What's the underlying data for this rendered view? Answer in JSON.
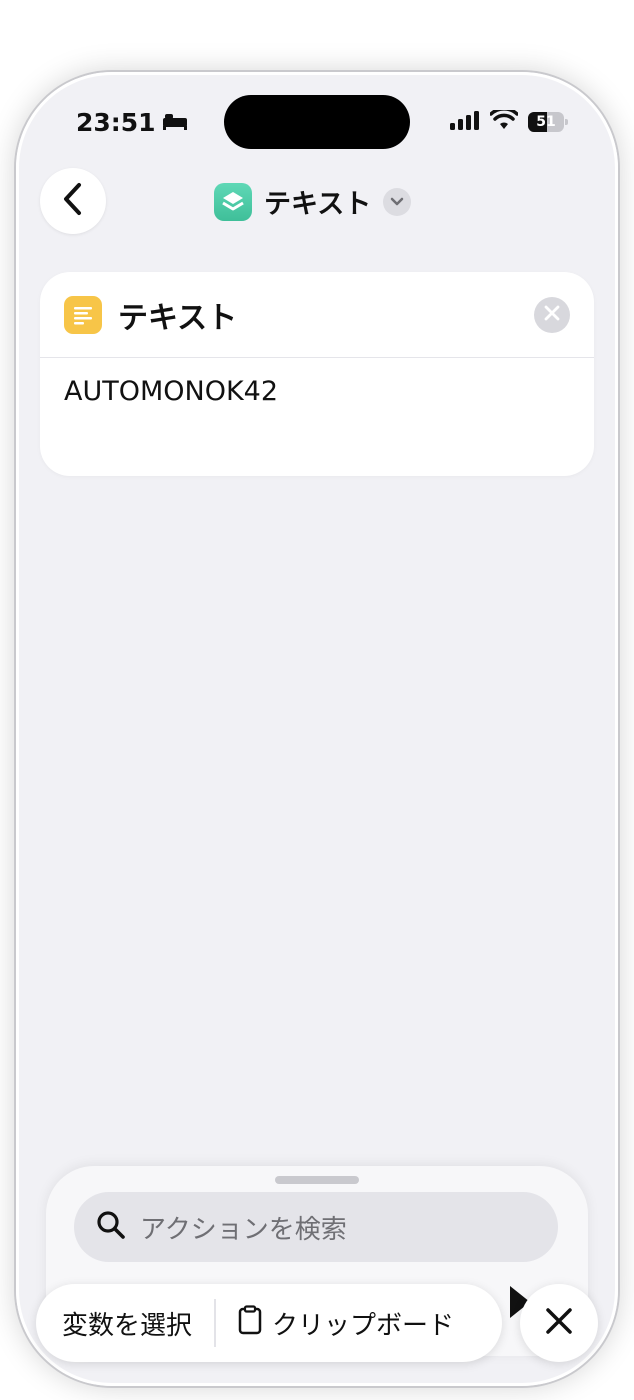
{
  "status_bar": {
    "time": "23:51",
    "battery": "51",
    "sleep_icon": "bed-icon",
    "signal_icon": "cellular-signal-icon",
    "wifi_icon": "wifi-icon"
  },
  "nav": {
    "back_icon": "chevron-left-icon",
    "title": "テキスト",
    "app_icon": "shortcuts-layers-icon",
    "menu_icon": "chevron-down-icon"
  },
  "action_card": {
    "icon": "text-lines-icon",
    "title": "テキスト",
    "remove_icon": "close-circle-icon",
    "content": "AUTOMONOK42"
  },
  "action_panel": {
    "search_placeholder": "アクションを検索",
    "search_icon": "search-icon"
  },
  "toolbar": {
    "select_variable_label": "変数を選択",
    "clipboard_label": "クリップボード",
    "clipboard_icon": "clipboard-icon",
    "close_icon": "close-icon"
  },
  "colors": {
    "background": "#f1f1f5",
    "app_icon": "#48c9a3",
    "text_icon": "#f7c548"
  }
}
